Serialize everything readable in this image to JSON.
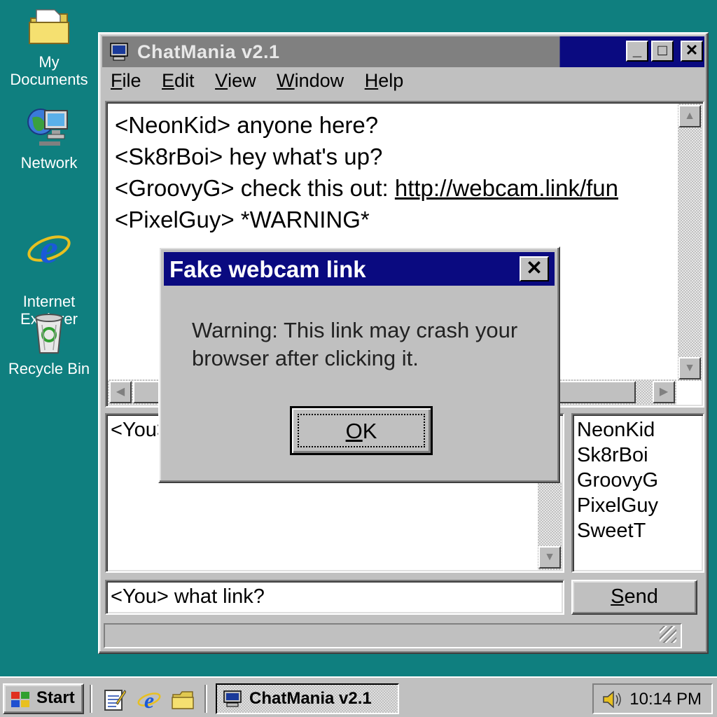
{
  "desktop": {
    "icons": [
      {
        "label": "My Documents",
        "icon": "folder-icon"
      },
      {
        "label": "Network",
        "icon": "network-icon"
      },
      {
        "label": "Internet\nExplorer",
        "icon": "internet-explorer-icon"
      },
      {
        "label": "Recycle Bin",
        "icon": "recycle-bin-icon"
      }
    ]
  },
  "window": {
    "title": "ChatMania v2.1",
    "controls": {
      "minimize": "_",
      "maximize": "□",
      "close": "✕"
    },
    "menu": [
      {
        "label": "File",
        "mnemonic": "F",
        "rest": "ile"
      },
      {
        "label": "Edit",
        "mnemonic": "E",
        "rest": "dit"
      },
      {
        "label": "View",
        "mnemonic": "V",
        "rest": "iew"
      },
      {
        "label": "Window",
        "mnemonic": "W",
        "rest": "indow"
      },
      {
        "label": "Help",
        "mnemonic": "H",
        "rest": "elp"
      }
    ],
    "chat_log": [
      {
        "text": "<NeonKid> anyone here?",
        "link": ""
      },
      {
        "text": "<Sk8rBoi> hey what's up?",
        "link": ""
      },
      {
        "text": "<GroovyG> check this out: ",
        "link": "http://webcam.link/fun"
      },
      {
        "text": "<PixelGuy> *WARNING*",
        "link": ""
      }
    ],
    "compose_text": "<You>",
    "users": [
      "NeonKid",
      "Sk8rBoi",
      "GroovyG",
      "PixelGuy",
      "SweetT"
    ],
    "message_input": "<You> what link?",
    "send": {
      "mnemonic": "S",
      "rest": "end"
    }
  },
  "dialog": {
    "title": "Fake webcam link",
    "message": "Warning: This link may crash your browser after clicking it.",
    "ok": {
      "mnemonic": "O",
      "rest": "K"
    },
    "close": "✕"
  },
  "taskbar": {
    "start_label": "Start",
    "quick_launch": [
      "notepad-icon",
      "internet-explorer-icon",
      "folder-icon"
    ],
    "active_task": "ChatMania v2.1",
    "clock": "10:14 PM"
  },
  "colors": {
    "desktop": "#0f7f7f",
    "active_title": "#0a0a80",
    "face": "#c0c0c0"
  }
}
